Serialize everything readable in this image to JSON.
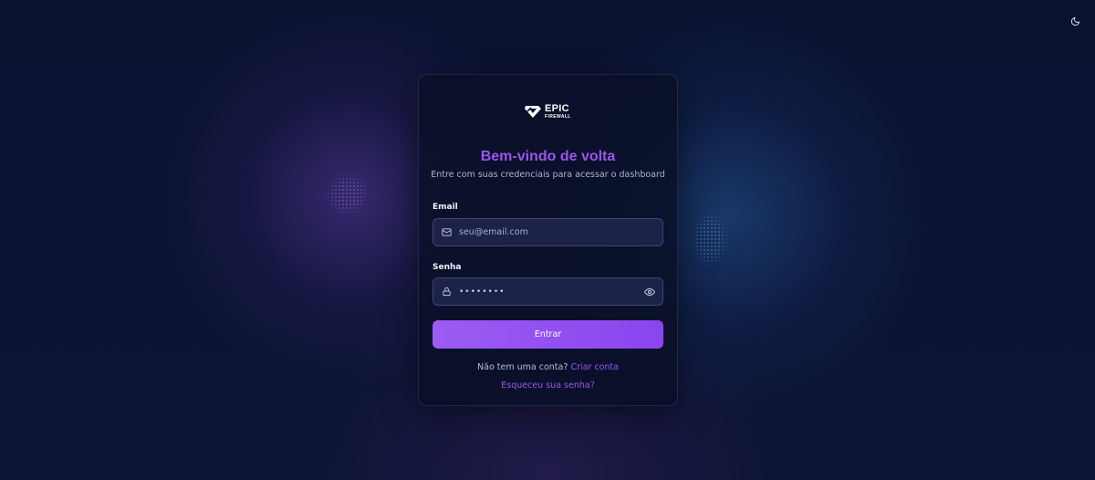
{
  "brand": {
    "logo_line1": "EPIC",
    "logo_line2": "FIREWALL",
    "accent": "#9a55ee"
  },
  "header": {
    "theme_toggle_icon": "moon-icon"
  },
  "login": {
    "title": "Bem-vindo de volta",
    "subtitle": "Entre com suas credenciais para acessar o dashboard",
    "email_label": "Email",
    "email_placeholder": "seu@email.com",
    "email_icon": "mail-icon",
    "password_label": "Senha",
    "password_value": "••••••••",
    "password_icon": "lock-icon",
    "password_toggle_icon": "eye-icon",
    "submit_label": "Entrar",
    "signup_prompt": "Não tem uma conta?",
    "signup_link": "Criar conta",
    "forgot_link": "Esqueceu sua senha?"
  }
}
